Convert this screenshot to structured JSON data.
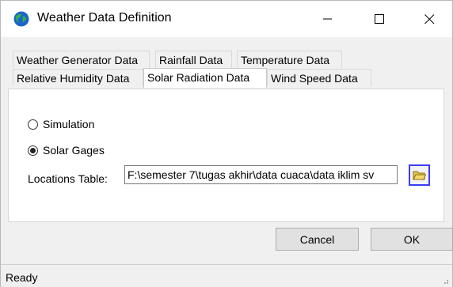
{
  "window": {
    "title": "Weather Data Definition",
    "icon": "globe-icon",
    "controls": [
      "minimize-icon",
      "maximize-icon",
      "close-icon"
    ]
  },
  "tabs": {
    "row1": [
      "Weather Generator Data",
      "Rainfall Data",
      "Temperature Data"
    ],
    "row2": [
      "Relative Humidity Data",
      "Solar Radiation Data",
      "Wind Speed Data"
    ],
    "active": "Solar Radiation Data"
  },
  "panel": {
    "option_simulation": "Simulation",
    "option_solar_gages": "Solar Gages",
    "selected_option": "Solar Gages",
    "locations_label": "Locations Table:",
    "locations_value": "F:\\semester 7\\tugas akhir\\data cuaca\\data iklim sv",
    "browse_icon": "folder-icon"
  },
  "buttons": {
    "cancel": "Cancel",
    "ok": "OK"
  },
  "status": {
    "text": "Ready"
  },
  "colors": {
    "browse_border": "#3b3bff",
    "panel_bg": "#ffffff",
    "window_bg": "#f0f0f0"
  }
}
